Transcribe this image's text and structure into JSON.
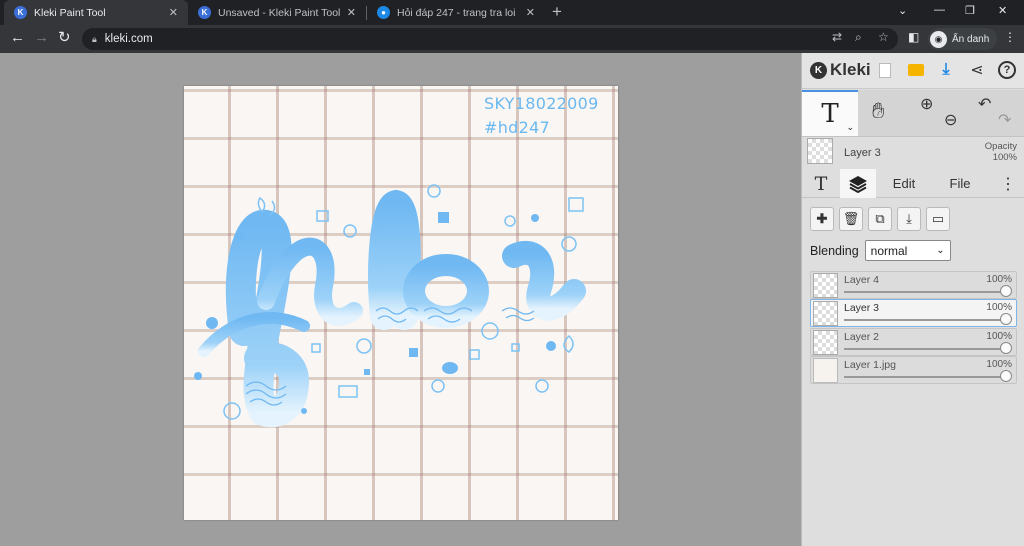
{
  "browser": {
    "tabs": [
      {
        "title": "Kleki Paint Tool",
        "active": true
      },
      {
        "title": "Unsaved - Kleki Paint Tool",
        "active": false
      },
      {
        "title": "Hỏi đáp 247 - trang tra loi",
        "active": false
      }
    ],
    "new_tab_label": "+",
    "url": "kleki.com",
    "profile_label": "Ẩn danh"
  },
  "canvas": {
    "watermark_line1": "SKY18022009",
    "watermark_line2": "#hd247",
    "drawing_color": "#7cc2f5"
  },
  "panel": {
    "brand": "Kleki",
    "tool_glyph": "T",
    "current_layer": {
      "name": "Layer 3",
      "opacity_label": "Opacity",
      "opacity_value": "100%"
    },
    "tabs": [
      {
        "label": "T",
        "icon": "text-tool-icon"
      },
      {
        "label": "",
        "icon": "layers-icon",
        "active": true
      },
      {
        "label": "Edit"
      },
      {
        "label": "File"
      }
    ],
    "blending_label": "Blending",
    "blending_value": "normal",
    "layers": [
      {
        "name": "Layer 4",
        "opacity": "100%",
        "active": false
      },
      {
        "name": "Layer 3",
        "opacity": "100%",
        "active": true
      },
      {
        "name": "Layer 2",
        "opacity": "100%",
        "active": false
      },
      {
        "name": "Layer 1.jpg",
        "opacity": "100%",
        "active": false
      }
    ]
  },
  "colors": {
    "accent": "#4a90e2",
    "brush_blue": "#7cc2f5"
  }
}
